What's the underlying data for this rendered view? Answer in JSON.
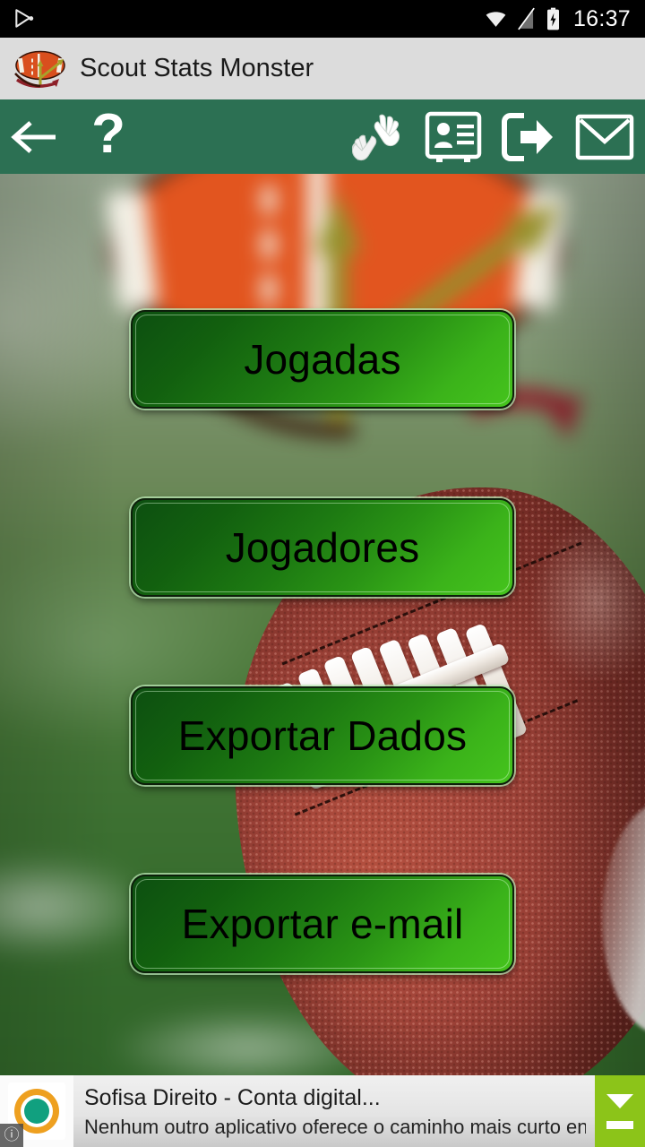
{
  "status_bar": {
    "notification_icon": "google-play-icon",
    "wifi_icon": "wifi-icon",
    "sim_icon": "no-sim-icon",
    "battery_icon": "battery-charging-icon",
    "time": "16:37"
  },
  "title_bar": {
    "logo_icon": "football-play-logo-icon",
    "title": "Scout Stats Monster",
    "background_color": "#dcdcdc"
  },
  "action_bar": {
    "background_color": "#2c7053",
    "items": [
      {
        "name": "back-arrow-icon",
        "label": "Voltar"
      },
      {
        "name": "help-question-icon",
        "label": "Ajuda"
      },
      {
        "name": "clapping-hands-icon",
        "label": "Aplausos"
      },
      {
        "name": "contact-card-icon",
        "label": "Cartao"
      },
      {
        "name": "logout-exit-icon",
        "label": "Sair"
      },
      {
        "name": "envelope-mail-icon",
        "label": "E-mail"
      }
    ]
  },
  "menu": {
    "accent_color": "#2a9415",
    "buttons": [
      {
        "id": "jogadas",
        "label": "Jogadas"
      },
      {
        "id": "jogadores",
        "label": "Jogadores"
      },
      {
        "id": "exportar-dados",
        "label": "Exportar Dados"
      },
      {
        "id": "exportar-email",
        "label": "Exportar e-mail"
      }
    ]
  },
  "ad_banner": {
    "icon": "sofisa-ring-icon",
    "info_badge": "ⓘ",
    "title": "Sofisa Direito - Conta digital...",
    "description": "Nenhum outro aplicativo oferece o caminho mais curto entre você e s...",
    "control_color": "#8cc419",
    "collapse_icon": "chevron-down-icon",
    "minimize_icon": "minimize-dash-icon"
  }
}
